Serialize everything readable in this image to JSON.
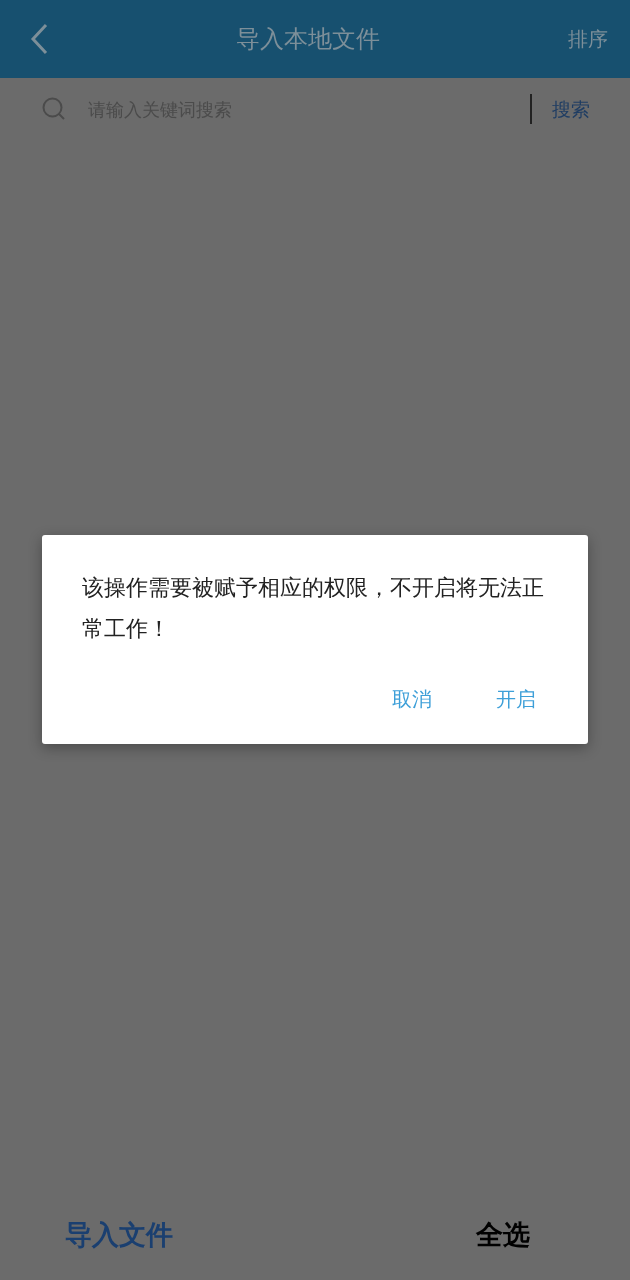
{
  "header": {
    "title": "导入本地文件",
    "action": "排序"
  },
  "search": {
    "placeholder": "请输入关键词搜索",
    "button": "搜索"
  },
  "dialog": {
    "message": "该操作需要被赋予相应的权限，不开启将无法正常工作！",
    "buttons": [
      "取消",
      "开启"
    ]
  },
  "bottom_bar": {
    "import_button": "导入文件",
    "select_all": "全选"
  }
}
